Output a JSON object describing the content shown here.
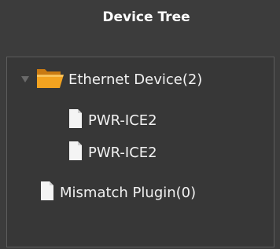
{
  "panel": {
    "title": "Device Tree"
  },
  "tree": {
    "root": {
      "label": "Ethernet Device(2)",
      "expanded": true,
      "icon": "folder-open-icon"
    },
    "children": [
      {
        "label": "PWR-ICE2",
        "icon": "file-icon"
      },
      {
        "label": "PWR-ICE2",
        "icon": "file-icon"
      }
    ],
    "sibling": {
      "label": "Mismatch Plugin(0)",
      "icon": "file-icon"
    }
  },
  "colors": {
    "background": "#3c3c3c",
    "text": "#f2f2f2",
    "folder": "#f3a320"
  }
}
